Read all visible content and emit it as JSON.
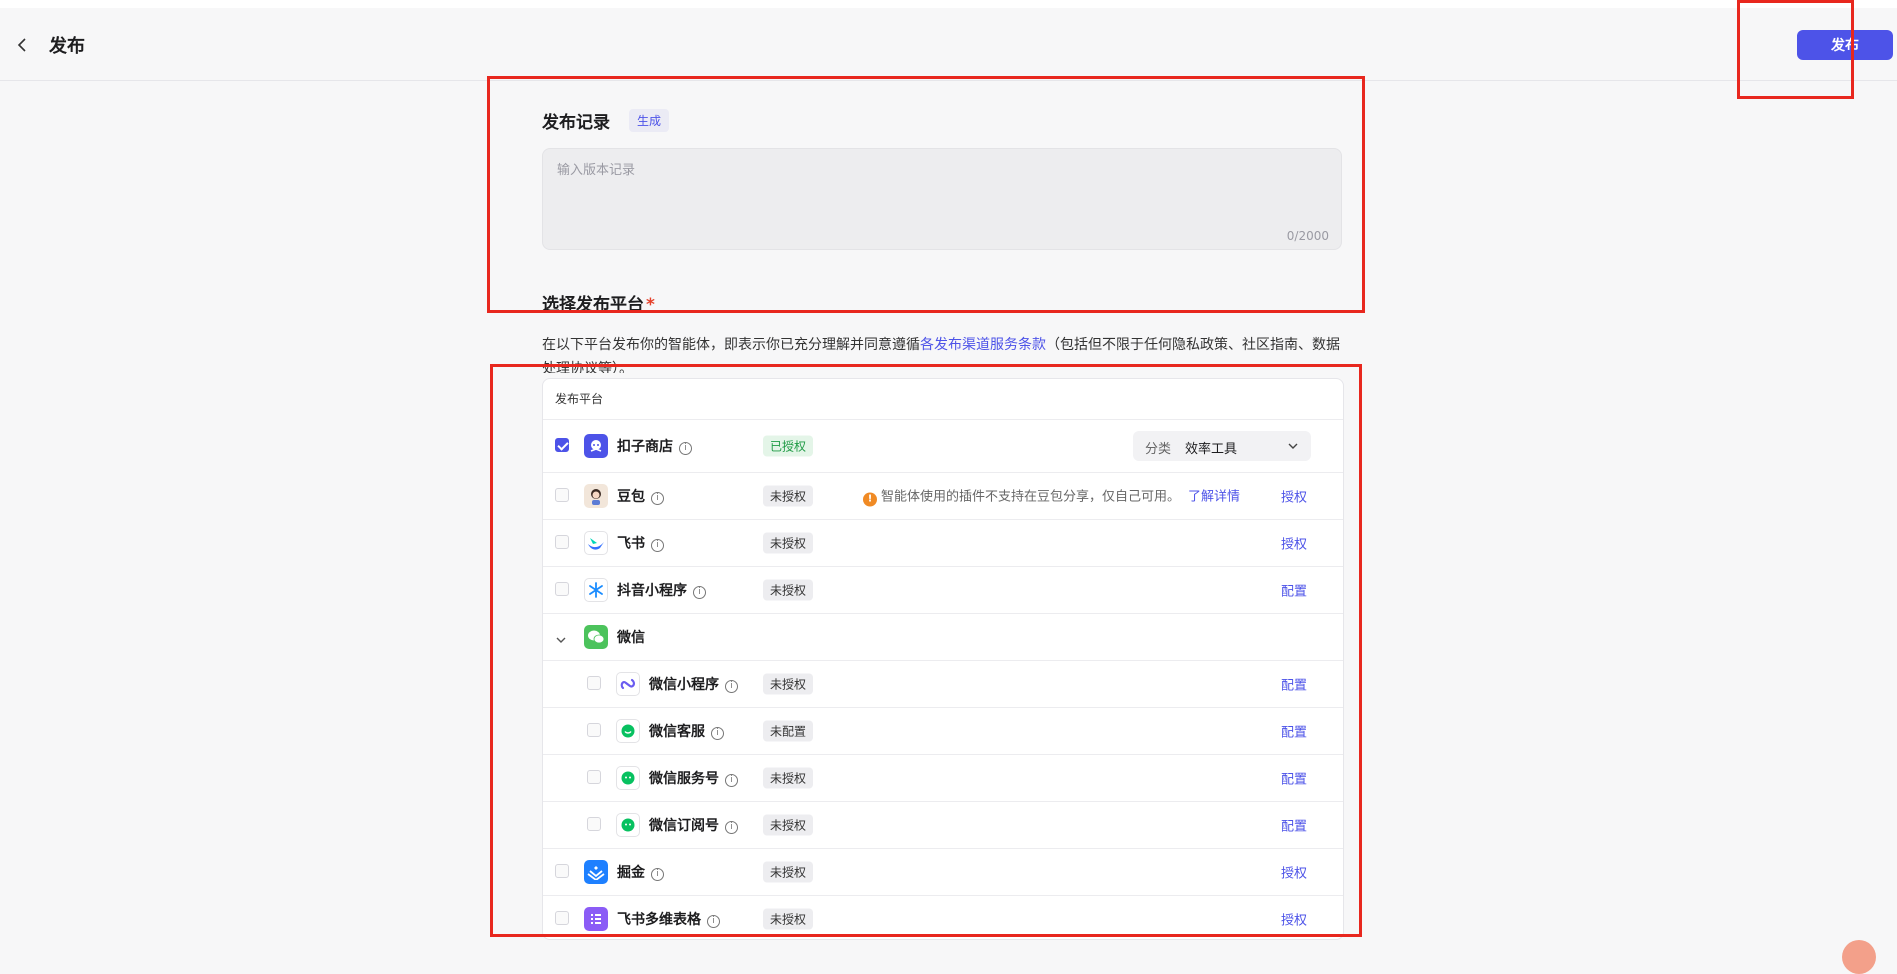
{
  "header": {
    "title": "发布",
    "publish_label": "发布"
  },
  "record": {
    "title": "发布记录",
    "generate_label": "生成",
    "placeholder": "输入版本记录",
    "count": "0/2000"
  },
  "platform_section": {
    "title": "选择发布平台",
    "required_mark": "*",
    "terms_prefix": "在以下平台发布你的智能体，即表示你已充分理解并同意遵循",
    "terms_link": "各发布渠道服务条款",
    "terms_suffix": "（包括但不限于任何隐私政策、社区指南、数据处理协议等）。",
    "table_header": "发布平台"
  },
  "platforms": [
    {
      "name": "扣子商店",
      "status": "已授权",
      "checked": true,
      "category_label": "分类",
      "category_value": "效率工具",
      "icon": "coze-store-icon",
      "color": "#4d53e8"
    },
    {
      "name": "豆包",
      "status": "未授权",
      "checked": false,
      "warning": "智能体使用的插件不支持在豆包分享，仅自己可用。",
      "warning_link": "了解详情",
      "action": "授权",
      "icon": "doubao-icon",
      "color": "#f2e6da"
    },
    {
      "name": "飞书",
      "status": "未授权",
      "checked": false,
      "action": "授权",
      "icon": "feishu-icon",
      "color": "#ffffff"
    },
    {
      "name": "抖音小程序",
      "status": "未授权",
      "checked": false,
      "action": "配置",
      "icon": "douyin-miniapp-icon",
      "color": "#ffffff"
    },
    {
      "name": "微信",
      "group": true,
      "icon": "wechat-icon",
      "color": "#4cc35c"
    },
    {
      "name": "微信小程序",
      "status": "未授权",
      "checked": false,
      "action": "配置",
      "icon": "wechat-miniapp-icon",
      "color": "#ffffff",
      "child": true
    },
    {
      "name": "微信客服",
      "status": "未配置",
      "checked": false,
      "action": "配置",
      "icon": "wechat-service-icon",
      "color": "#ffffff",
      "child": true
    },
    {
      "name": "微信服务号",
      "status": "未授权",
      "checked": false,
      "action": "配置",
      "icon": "wechat-official-icon",
      "color": "#ffffff",
      "child": true
    },
    {
      "name": "微信订阅号",
      "status": "未授权",
      "checked": false,
      "action": "配置",
      "icon": "wechat-subscription-icon",
      "color": "#ffffff",
      "child": true
    },
    {
      "name": "掘金",
      "status": "未授权",
      "checked": false,
      "action": "授权",
      "icon": "juejin-icon",
      "color": "#1e80ff"
    },
    {
      "name": "飞书多维表格",
      "status": "未授权",
      "checked": false,
      "action": "授权",
      "icon": "feishu-bitable-icon",
      "color": "#8b5cf6"
    }
  ],
  "colors": {
    "accent": "#4d53e8",
    "annotation": "#e8271e"
  }
}
